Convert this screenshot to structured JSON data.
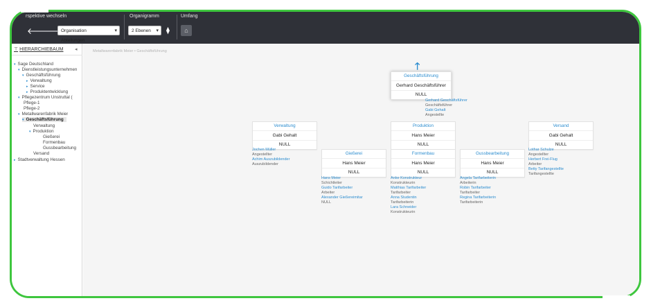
{
  "toolbar": {
    "perspective_label": "rspektive wechseln",
    "back_icon": "arrow-left-icon",
    "forward_icon": "arrow-right-icon",
    "perspective_value": "Organisation Abteilungen",
    "orgchart_label": "Organigramm",
    "levels_value": "2 Ebenen",
    "scope_label": "Umfang",
    "org_icon": "hierarchy-icon",
    "scope_icon": "scope-icon"
  },
  "sidebar": {
    "title": "HIERARCHIEBAUM",
    "collapse_glyph": "◂",
    "items": [
      {
        "label": "Sage Deutschland",
        "caret": "▾"
      },
      {
        "label": "Dienstleistungsunternehmen",
        "caret": "▾"
      },
      {
        "label": "Geschäftsführung",
        "caret": "▾"
      },
      {
        "label": "Verwaltung",
        "caret": "▸"
      },
      {
        "label": "Service",
        "caret": "▸"
      },
      {
        "label": "Produktentwicklung",
        "caret": "▸"
      },
      {
        "label": "Pflegezentrum Unstruttal (",
        "caret": "▾"
      },
      {
        "label": "Pflege-1",
        "caret": ""
      },
      {
        "label": "Pflege-2",
        "caret": ""
      },
      {
        "label": "Metallwarenfabrik Meier",
        "caret": "▾"
      },
      {
        "label": "Geschäftsführung",
        "caret": "▾"
      },
      {
        "label": "Verwaltung",
        "caret": ""
      },
      {
        "label": "Produktion",
        "caret": "▾"
      },
      {
        "label": "Gießerei",
        "caret": ""
      },
      {
        "label": "Formenbau",
        "caret": ""
      },
      {
        "label": "Gussbearbeitung",
        "caret": ""
      },
      {
        "label": "Versand",
        "caret": ""
      },
      {
        "label": "Stadtverwaltung Hessen",
        "caret": "▸"
      }
    ]
  },
  "breadcrumb": "Metallwarenfabrik Meier  •  Geschäftsführung",
  "orgchart": {
    "root": {
      "dept": "Geschäftsführung",
      "name": "Gerhard Geschäftsführer",
      "null": "NULL",
      "members": [
        {
          "name": "Gerhard Geschäftsführer",
          "role": "Geschäftsführer"
        },
        {
          "name": "Gabi Gehalt",
          "role": "Angestellte"
        }
      ]
    },
    "verwaltung": {
      "dept": "Verwaltung",
      "name": "Gabi Gehalt",
      "null": "NULL",
      "members": [
        {
          "name": "Jochen Müller",
          "role": "Angestellter"
        },
        {
          "name": "Achim Auszubildender",
          "role": "Auszubildender"
        }
      ]
    },
    "produktion": {
      "dept": "Produktion",
      "name": "Hans Meier",
      "null": "NULL"
    },
    "versand": {
      "dept": "Versand",
      "name": "Gabi Gehalt",
      "null": "NULL",
      "members": [
        {
          "name": "Lothar Schulze",
          "role": "Angestellter"
        },
        {
          "name": "Herbert Frei-Flug",
          "role": "Arbeiter"
        },
        {
          "name": "Betty Tarifangestellte",
          "role": "Tarifangestellte"
        }
      ]
    },
    "giesserei": {
      "dept": "Gießerei",
      "name": "Hans Meier",
      "null": "NULL",
      "members": [
        {
          "name": "Hans Meier",
          "role": "Schichtleiter"
        },
        {
          "name": "Guido Tarifarbeiter",
          "role": "Arbeiter"
        },
        {
          "name": "Alexander Gießereimitar",
          "role": "NULL"
        }
      ]
    },
    "formenbau": {
      "dept": "Formenbau",
      "name": "Hans Meier",
      "null": "NULL",
      "members": [
        {
          "name": "Anke Konstrukteur",
          "role": "Konstrukteurin"
        },
        {
          "name": "Matthias Tarifarbeiter",
          "role": "Tarifarbeiter"
        },
        {
          "name": "Anna Studentin",
          "role": "Tarifarbeiterin"
        },
        {
          "name": "Lara Schneider",
          "role": "Konstrukteurin"
        }
      ]
    },
    "gussbearbeitung": {
      "dept": "Gussbearbeitung",
      "name": "Hans Meier",
      "null": "NULL",
      "members": [
        {
          "name": "Angela Tarifarbeiterin",
          "role": "Arbeiterin"
        },
        {
          "name": "Robin Tarifarbeiter",
          "role": "Tarifarbeiter"
        },
        {
          "name": "Regina Tarifarbeiterin",
          "role": "Tarifarbeiterin"
        }
      ]
    }
  },
  "colors": {
    "accent": "#2b8ccf",
    "toolbar": "#2f3138",
    "frame": "#3ec63e"
  }
}
